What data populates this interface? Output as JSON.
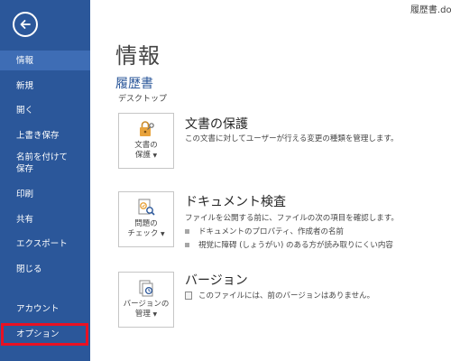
{
  "window": {
    "title": "履歴書.docx"
  },
  "sidebar": {
    "items": [
      {
        "label": "情報",
        "active": true
      },
      {
        "label": "新規"
      },
      {
        "label": "開く"
      },
      {
        "label": "上書き保存"
      },
      {
        "label": "名前を付けて保存"
      },
      {
        "label": "印刷"
      },
      {
        "label": "共有"
      },
      {
        "label": "エクスポート"
      },
      {
        "label": "閉じる"
      },
      {
        "label": "アカウント"
      },
      {
        "label": "オプション",
        "highlighted": true
      }
    ]
  },
  "main": {
    "title": "情報",
    "doc_name": "履歴書",
    "doc_location": "デスクトップ",
    "sections": [
      {
        "tile_label_1": "文書の",
        "tile_label_2": "保護",
        "title": "文書の保護",
        "description": "この文書に対してユーザーが行える変更の種類を管理します。",
        "icon": "lock-key-icon"
      },
      {
        "tile_label_1": "問題の",
        "tile_label_2": "チェック",
        "title": "ドキュメント検査",
        "description": "ファイルを公開する前に、ファイルの次の項目を確認します。",
        "bullets": [
          "ドキュメントのプロパティ、作成者の名前",
          "視覚に障碍 (しょうがい) のある方が読み取りにくい内容"
        ],
        "icon": "inspect-document-icon"
      },
      {
        "tile_label_1": "バージョンの",
        "tile_label_2": "管理",
        "title": "バージョン",
        "description": "このファイルには、前のバージョンはありません。",
        "icon": "version-history-icon"
      }
    ]
  },
  "colors": {
    "sidebar_bg": "#2b579a",
    "sidebar_active": "#3e6db5",
    "highlight_border": "#e81123",
    "accent_text": "#2b579a"
  }
}
